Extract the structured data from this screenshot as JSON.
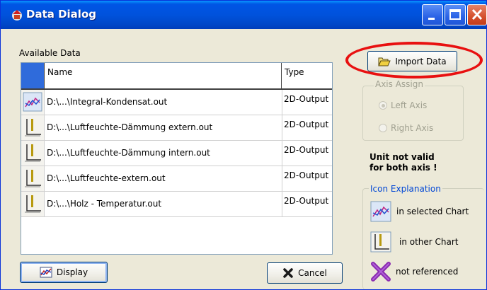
{
  "window": {
    "title": "Data Dialog"
  },
  "available_label": "Available Data",
  "table": {
    "columns": [
      "Name",
      "Type"
    ],
    "rows": [
      {
        "icon": "selected-chart-icon",
        "name": "D:\\...\\Integral-Kondensat.out",
        "type": "2D-Output"
      },
      {
        "icon": "other-chart-icon",
        "name": "D:\\...\\Luftfeuchte-Dämmung extern.out",
        "type": "2D-Output"
      },
      {
        "icon": "other-chart-icon",
        "name": "D:\\...\\Luftfeuchte-Dämmung intern.out",
        "type": "2D-Output"
      },
      {
        "icon": "other-chart-icon",
        "name": "D:\\...\\Luftfeuchte-extern.out",
        "type": "2D-Output"
      },
      {
        "icon": "other-chart-icon",
        "name": "D:\\...\\Holz - Temperatur.out",
        "type": "2D-Output"
      }
    ]
  },
  "buttons": {
    "import": "Import Data",
    "display": "Display",
    "cancel": "Cancel"
  },
  "axis_assign": {
    "legend": "Axis Assign",
    "left": "Left Axis",
    "right": "Right Axis",
    "selected": "left"
  },
  "warning": {
    "line1": "Unit not valid",
    "line2": "for both axis !"
  },
  "icon_explanation": {
    "legend": "Icon Explanation",
    "selected": "in selected Chart",
    "other": "in other Chart",
    "not_referenced": "not referenced"
  },
  "colors": {
    "titlebar": "#0055e5",
    "highlight": "#e81010",
    "header_corner": "#2f6bdb"
  }
}
